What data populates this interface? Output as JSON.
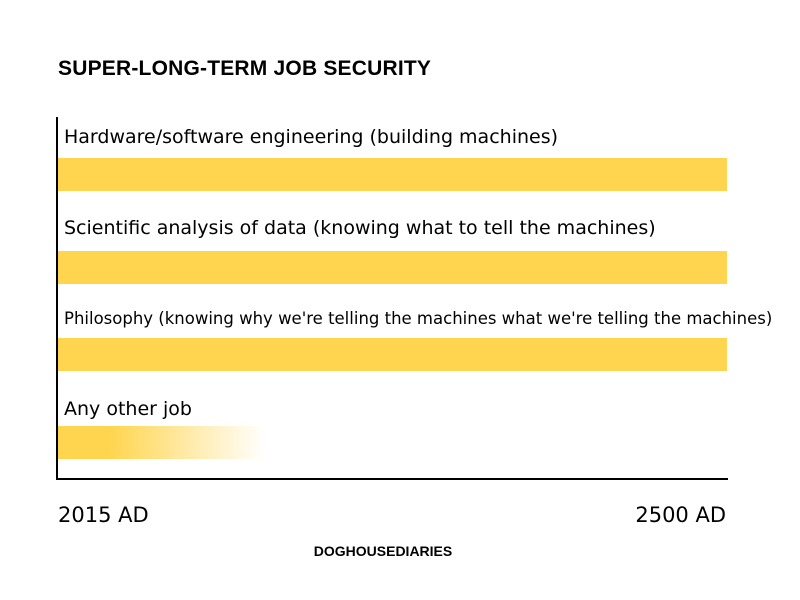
{
  "chart_data": {
    "type": "bar",
    "orientation": "horizontal",
    "title": "SUPER-LONG-TERM JOB SECURITY",
    "categories": [
      "Hardware/software engineering (building machines)",
      "Scientific analysis of data (knowing what to tell the machines)",
      "Philosophy (knowing why we're telling the machines what we're telling the machines)",
      "Any other job"
    ],
    "values": [
      2500,
      2500,
      2500,
      2165
    ],
    "bar_style": [
      "solid",
      "solid",
      "solid",
      "fade-out"
    ],
    "xlim": [
      2015,
      2500
    ],
    "x_tick_labels": [
      "2015 AD",
      "2500 AD"
    ],
    "xlabel": "",
    "ylabel": "",
    "grid": false,
    "colors": {
      "bar": "#FFD54F",
      "axis": "#000000"
    }
  },
  "credit": "DOGHOUSEDIARIES"
}
